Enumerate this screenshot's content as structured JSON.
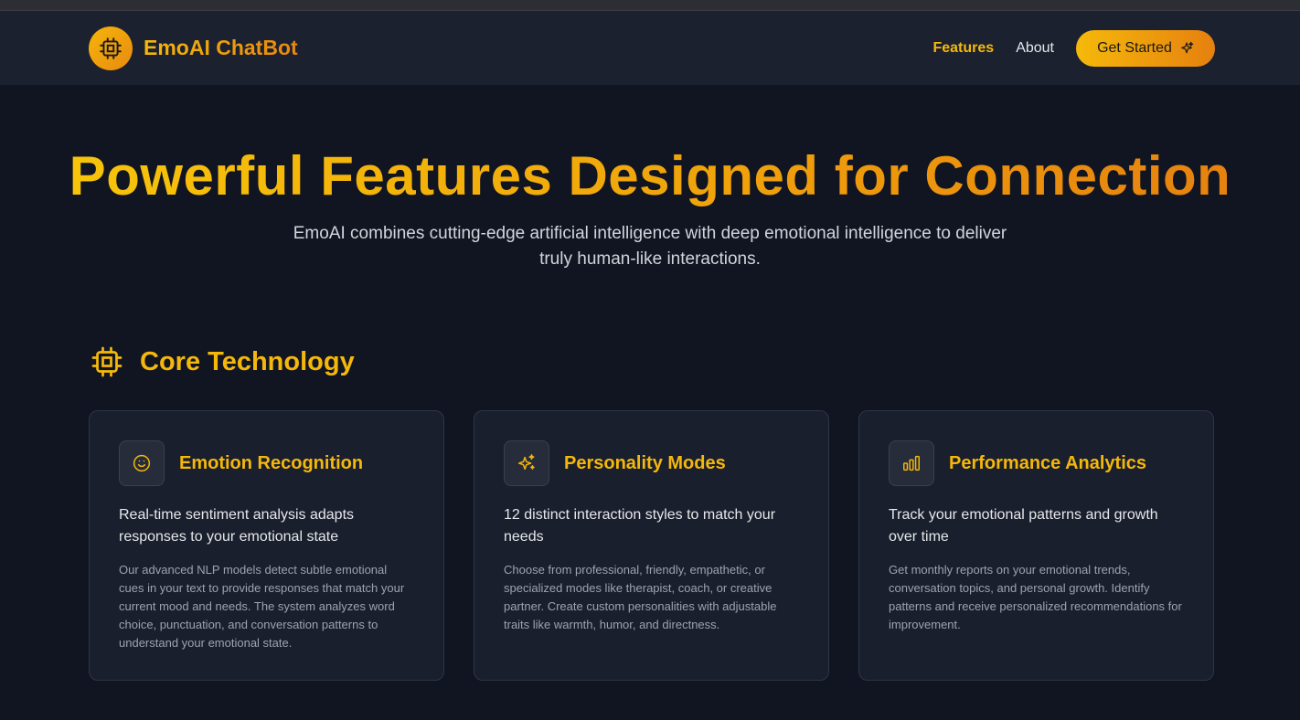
{
  "nav": {
    "brand": "EmoAI ChatBot",
    "links": [
      "Features",
      "About"
    ],
    "cta": "Get Started"
  },
  "hero": {
    "title": "Powerful Features Designed for Connection",
    "subtitle": "EmoAI combines cutting-edge artificial intelligence with deep emotional intelligence to deliver truly human-like interactions."
  },
  "section": {
    "title": "Core Technology"
  },
  "cards": [
    {
      "title": "Emotion Recognition",
      "icon": "smile-icon",
      "lead": "Real-time sentiment analysis adapts responses to your emotional state",
      "body": "Our advanced NLP models detect subtle emotional cues in your text to provide responses that match your current mood and needs. The system analyzes word choice, punctuation, and conversation patterns to understand your emotional state."
    },
    {
      "title": "Personality Modes",
      "icon": "sparkles-icon",
      "lead": "12 distinct interaction styles to match your needs",
      "body": "Choose from professional, friendly, empathetic, or specialized modes like therapist, coach, or creative partner. Create custom personalities with adjustable traits like warmth, humor, and directness."
    },
    {
      "title": "Performance Analytics",
      "icon": "bar-chart-icon",
      "lead": "Track your emotional patterns and growth over time",
      "body": "Get monthly reports on your emotional trends, conversation topics, and personal growth. Identify patterns and receive personalized recommendations for improvement."
    }
  ],
  "colors": {
    "accent": "#f5b80a",
    "accent_end": "#e6820f",
    "background": "#111522",
    "card": "#1a1f2d"
  }
}
